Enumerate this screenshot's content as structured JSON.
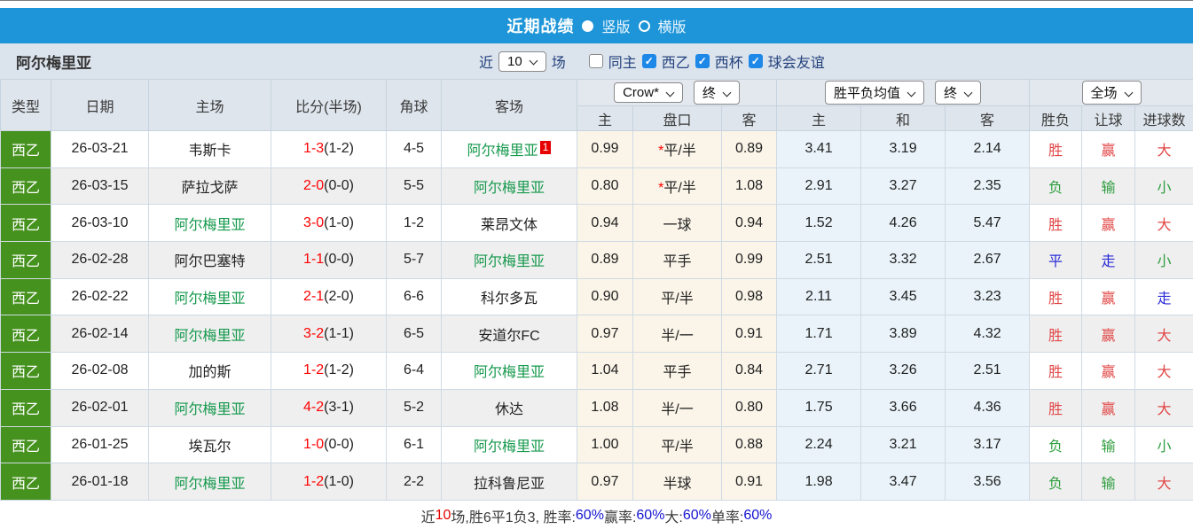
{
  "topbar": {
    "title": "近期战绩",
    "view_options": [
      {
        "label": "竖版",
        "selected": true
      },
      {
        "label": "横版",
        "selected": false
      }
    ]
  },
  "filterbar": {
    "team": "阿尔梅里亚",
    "near_label": "近",
    "count_select_value": "10",
    "games_label": "场",
    "checkboxes": [
      {
        "label": "同主",
        "checked": false
      },
      {
        "label": "西乙",
        "checked": true
      },
      {
        "label": "西杯",
        "checked": true
      },
      {
        "label": "球会友谊",
        "checked": true
      }
    ]
  },
  "table": {
    "left_headers": [
      "类型",
      "日期",
      "主场",
      "比分(半场)",
      "角球",
      "客场"
    ],
    "groups": [
      {
        "selects": [
          "Crow*",
          "终"
        ],
        "cols": [
          "主",
          "盘口",
          "客"
        ]
      },
      {
        "selects": [
          "胜平负均值",
          "终"
        ],
        "cols": [
          "主",
          "和",
          "客"
        ]
      },
      {
        "selects": [
          "全场"
        ],
        "cols": [
          "胜负",
          "让球",
          "进球数"
        ]
      }
    ],
    "rows": [
      {
        "type": "西乙",
        "date": "26-03-21",
        "home": "韦斯卡",
        "home_green": false,
        "score": "1-3",
        "half": "(1-2)",
        "corner": "4-5",
        "away": "阿尔梅里亚",
        "away_green": true,
        "away_badge": "1",
        "odds_home": "0.99",
        "handicap_star": "*",
        "handicap": "平/半",
        "odds_away": "0.89",
        "avg_home": "3.41",
        "avg_draw": "3.19",
        "avg_away": "2.14",
        "res_wdl": "胜",
        "res_wdl_c": "red",
        "res_let": "赢",
        "res_let_c": "red",
        "res_goal": "大",
        "res_goal_c": "red"
      },
      {
        "type": "西乙",
        "date": "26-03-15",
        "home": "萨拉戈萨",
        "home_green": false,
        "score": "2-0",
        "half": "(0-0)",
        "corner": "5-5",
        "away": "阿尔梅里亚",
        "away_green": true,
        "odds_home": "0.80",
        "handicap_star": "*",
        "handicap": "平/半",
        "odds_away": "1.08",
        "avg_home": "2.91",
        "avg_draw": "3.27",
        "avg_away": "2.35",
        "res_wdl": "负",
        "res_wdl_c": "green",
        "res_let": "输",
        "res_let_c": "green",
        "res_goal": "小",
        "res_goal_c": "green"
      },
      {
        "type": "西乙",
        "date": "26-03-10",
        "home": "阿尔梅里亚",
        "home_green": true,
        "score": "3-0",
        "half": "(1-0)",
        "corner": "1-2",
        "away": "莱昂文体",
        "away_green": false,
        "odds_home": "0.94",
        "handicap": "一球",
        "odds_away": "0.94",
        "avg_home": "1.52",
        "avg_draw": "4.26",
        "avg_away": "5.47",
        "res_wdl": "胜",
        "res_wdl_c": "red",
        "res_let": "赢",
        "res_let_c": "red",
        "res_goal": "大",
        "res_goal_c": "red"
      },
      {
        "type": "西乙",
        "date": "26-02-28",
        "home": "阿尔巴塞特",
        "home_green": false,
        "score": "1-1",
        "half": "(0-0)",
        "corner": "5-7",
        "away": "阿尔梅里亚",
        "away_green": true,
        "odds_home": "0.89",
        "handicap": "平手",
        "odds_away": "0.99",
        "avg_home": "2.51",
        "avg_draw": "3.32",
        "avg_away": "2.67",
        "res_wdl": "平",
        "res_wdl_c": "blue",
        "res_let": "走",
        "res_let_c": "blue",
        "res_goal": "小",
        "res_goal_c": "green"
      },
      {
        "type": "西乙",
        "date": "26-02-22",
        "home": "阿尔梅里亚",
        "home_green": true,
        "score": "2-1",
        "half": "(2-0)",
        "corner": "6-6",
        "away": "科尔多瓦",
        "away_green": false,
        "odds_home": "0.90",
        "handicap": "平/半",
        "odds_away": "0.98",
        "avg_home": "2.11",
        "avg_draw": "3.45",
        "avg_away": "3.23",
        "res_wdl": "胜",
        "res_wdl_c": "red",
        "res_let": "赢",
        "res_let_c": "red",
        "res_goal": "走",
        "res_goal_c": "blue"
      },
      {
        "type": "西乙",
        "date": "26-02-14",
        "home": "阿尔梅里亚",
        "home_green": true,
        "score": "3-2",
        "half": "(1-1)",
        "corner": "6-5",
        "away": "安道尔FC",
        "away_green": false,
        "odds_home": "0.97",
        "handicap": "半/一",
        "odds_away": "0.91",
        "avg_home": "1.71",
        "avg_draw": "3.89",
        "avg_away": "4.32",
        "res_wdl": "胜",
        "res_wdl_c": "red",
        "res_let": "赢",
        "res_let_c": "red",
        "res_goal": "大",
        "res_goal_c": "red"
      },
      {
        "type": "西乙",
        "date": "26-02-08",
        "home": "加的斯",
        "home_green": false,
        "score": "1-2",
        "half": "(1-2)",
        "corner": "6-4",
        "away": "阿尔梅里亚",
        "away_green": true,
        "odds_home": "1.04",
        "handicap": "平手",
        "odds_away": "0.84",
        "avg_home": "2.71",
        "avg_draw": "3.26",
        "avg_away": "2.51",
        "res_wdl": "胜",
        "res_wdl_c": "red",
        "res_let": "赢",
        "res_let_c": "red",
        "res_goal": "大",
        "res_goal_c": "red"
      },
      {
        "type": "西乙",
        "date": "26-02-01",
        "home": "阿尔梅里亚",
        "home_green": true,
        "score": "4-2",
        "half": "(3-1)",
        "corner": "5-2",
        "away": "休达",
        "away_green": false,
        "odds_home": "1.08",
        "handicap": "半/一",
        "odds_away": "0.80",
        "avg_home": "1.75",
        "avg_draw": "3.66",
        "avg_away": "4.36",
        "res_wdl": "胜",
        "res_wdl_c": "red",
        "res_let": "赢",
        "res_let_c": "red",
        "res_goal": "大",
        "res_goal_c": "red"
      },
      {
        "type": "西乙",
        "date": "26-01-25",
        "home": "埃瓦尔",
        "home_green": false,
        "score": "1-0",
        "half": "(0-0)",
        "corner": "6-1",
        "away": "阿尔梅里亚",
        "away_green": true,
        "odds_home": "1.00",
        "handicap": "平/半",
        "odds_away": "0.88",
        "avg_home": "2.24",
        "avg_draw": "3.21",
        "avg_away": "3.17",
        "res_wdl": "负",
        "res_wdl_c": "green",
        "res_let": "输",
        "res_let_c": "green",
        "res_goal": "小",
        "res_goal_c": "green"
      },
      {
        "type": "西乙",
        "date": "26-01-18",
        "home": "阿尔梅里亚",
        "home_green": true,
        "score": "1-2",
        "half": "(1-0)",
        "corner": "2-2",
        "away": "拉科鲁尼亚",
        "away_green": false,
        "odds_home": "0.97",
        "handicap": "半球",
        "odds_away": "0.91",
        "avg_home": "1.98",
        "avg_draw": "3.47",
        "avg_away": "3.56",
        "res_wdl": "负",
        "res_wdl_c": "green",
        "res_let": "输",
        "res_let_c": "green",
        "res_goal": "大",
        "res_goal_c": "red"
      }
    ]
  },
  "footer": {
    "segments": [
      {
        "t": "近",
        "c": "dark"
      },
      {
        "t": "10",
        "c": "red"
      },
      {
        "t": "场,胜6平1负3, 胜率:",
        "c": "dark"
      },
      {
        "t": "60%",
        "c": "blue"
      },
      {
        "t": " 赢率:",
        "c": "dark"
      },
      {
        "t": "60%",
        "c": "blue"
      },
      {
        "t": " 大:",
        "c": "dark"
      },
      {
        "t": "60%",
        "c": "blue"
      },
      {
        "t": " 单率:",
        "c": "dark"
      },
      {
        "t": "60%",
        "c": "blue"
      }
    ]
  },
  "colors": {
    "topbar_blue": "#1d95d8",
    "filterbar_bg": "#dbe3ed",
    "header_bg": "#dee5ec",
    "league_green": "#46921e",
    "team_green": "#16994d",
    "score_red": "#ff0000",
    "result_red": "#e14646",
    "result_blue": "#2b2bd8",
    "result_green": "#2f9e3f",
    "odds_col_bg": "#fbf5e9",
    "avg_col_bg": "#e9f3f9",
    "checkbox_blue": "#1e88e8",
    "footer_value_blue": "#1414d2"
  }
}
